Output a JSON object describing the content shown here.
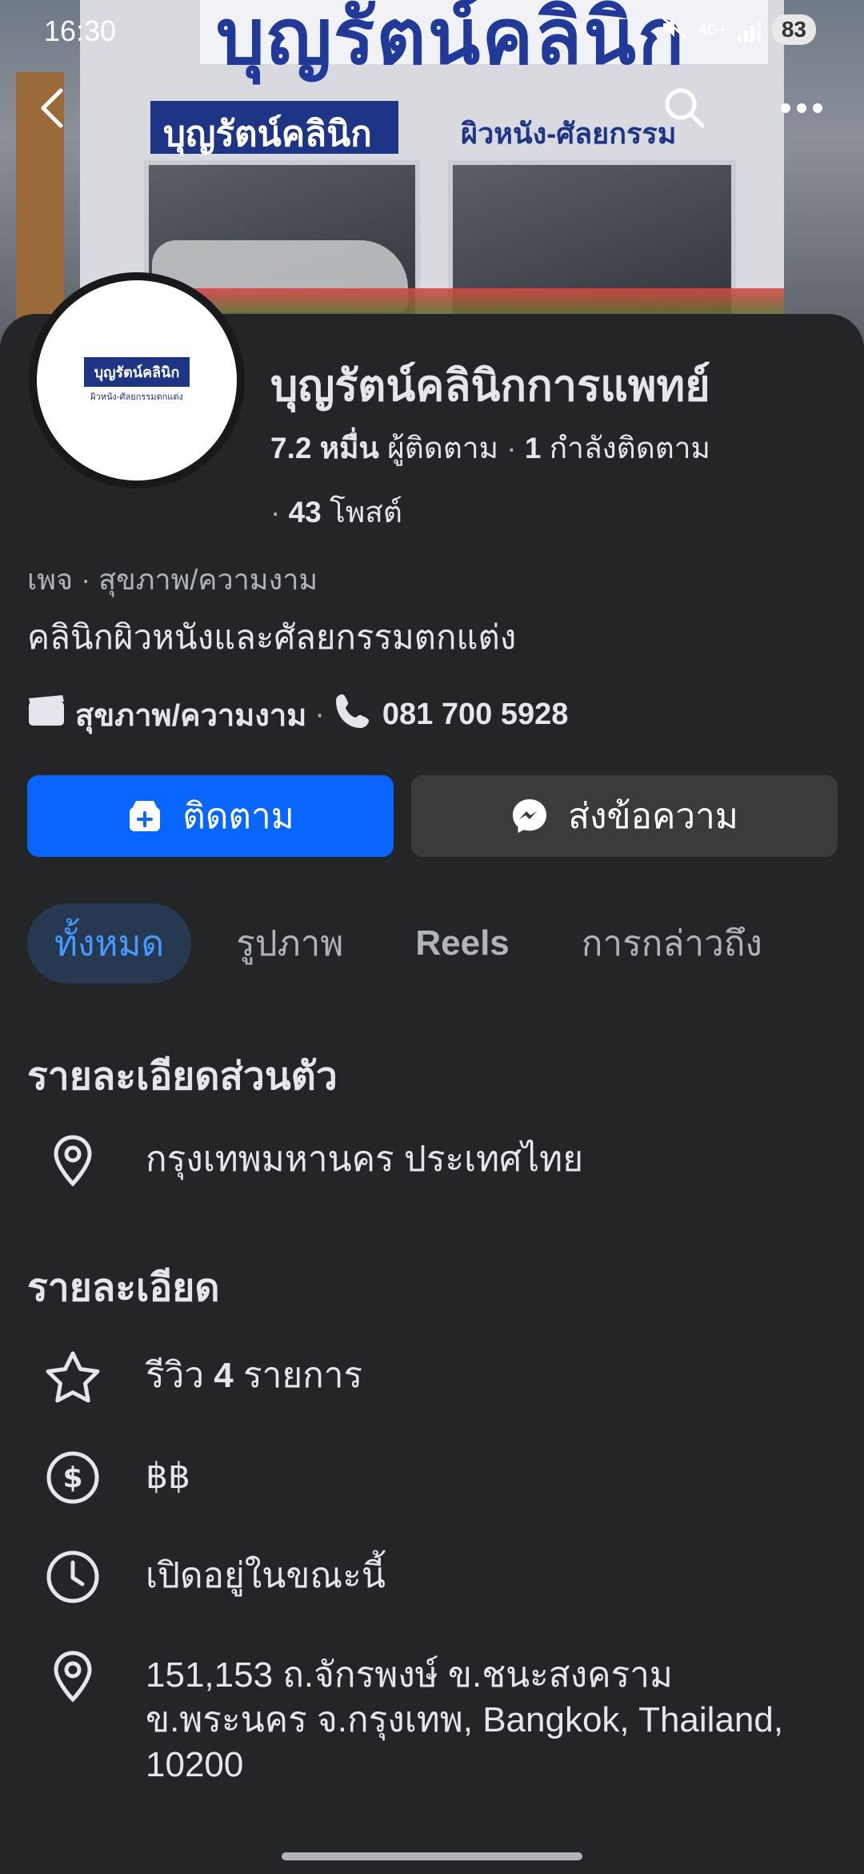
{
  "status_bar": {
    "time": "16:30",
    "network": "4G+",
    "battery": "83"
  },
  "cover": {
    "sign_top": "บุญรัตน์คลินิก",
    "sign_blue": "บุญรัตน์คลินิก",
    "sign_right": "ผิวหนัง-ศัลยกรรมตกแต่ง"
  },
  "avatar": {
    "logo_main": "บุญรัตน์คลินิก",
    "logo_sub": "ผิวหนัง-ศัลยกรรมตกแต่ง"
  },
  "profile": {
    "name": "บุญรัตน์คลินิกการแพทย์",
    "followers_count": "7.2 หมื่น",
    "followers_label": "ผู้ติดตาม",
    "following_count": "1",
    "following_label": "กำลังติดตาม",
    "posts_count": "43",
    "posts_label": "โพสต์",
    "category_line": "เพจ · สุขภาพ/ความงาม",
    "bio": "คลินิกผิวหนังและศัลยกรรมตกแต่ง",
    "category": "สุขภาพ/ความงาม",
    "phone": "081 700 5928"
  },
  "actions": {
    "follow": "ติดตาม",
    "message": "ส่งข้อความ"
  },
  "tabs": [
    {
      "label": "ทั้งหมด"
    },
    {
      "label": "รูปภาพ"
    },
    {
      "label": "Reels"
    },
    {
      "label": "การกล่าวถึง"
    }
  ],
  "personal_details": {
    "title": "รายละเอียดส่วนตัว",
    "location": "กรุงเทพมหานคร ประเทศไทย"
  },
  "details": {
    "title": "รายละเอียด",
    "reviews_prefix": "รีวิว",
    "reviews_count": "4",
    "reviews_suffix": "รายการ",
    "price": "฿฿",
    "hours": "เปิดอยู่ในขณะนี้",
    "address_line1": "151,153 ถ.จักรพงษ์ ข.ชนะสงคราม",
    "address_line2": "ข.พระนคร จ.กรุงเทพ, Bangkok, Thailand,",
    "address_line3": "10200"
  },
  "colors": {
    "accent": "#0866ff",
    "background": "#242526",
    "tab_active_bg": "#263951",
    "tab_active_text": "#4599ff"
  }
}
